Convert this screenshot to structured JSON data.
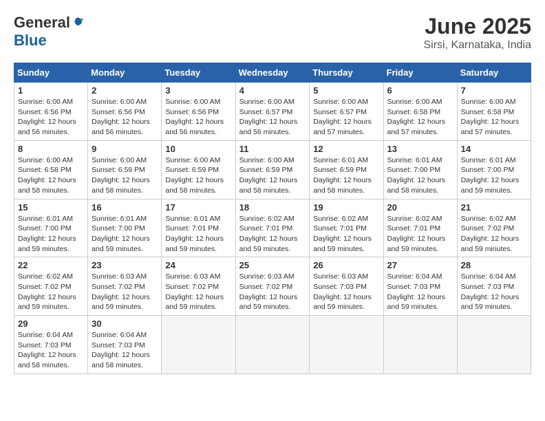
{
  "logo": {
    "general": "General",
    "blue": "Blue"
  },
  "title": "June 2025",
  "subtitle": "Sirsi, Karnataka, India",
  "days_of_week": [
    "Sunday",
    "Monday",
    "Tuesday",
    "Wednesday",
    "Thursday",
    "Friday",
    "Saturday"
  ],
  "weeks": [
    [
      {
        "num": "1",
        "info": "Sunrise: 6:00 AM\nSunset: 6:56 PM\nDaylight: 12 hours\nand 56 minutes."
      },
      {
        "num": "2",
        "info": "Sunrise: 6:00 AM\nSunset: 6:56 PM\nDaylight: 12 hours\nand 56 minutes."
      },
      {
        "num": "3",
        "info": "Sunrise: 6:00 AM\nSunset: 6:56 PM\nDaylight: 12 hours\nand 56 minutes."
      },
      {
        "num": "4",
        "info": "Sunrise: 6:00 AM\nSunset: 6:57 PM\nDaylight: 12 hours\nand 56 minutes."
      },
      {
        "num": "5",
        "info": "Sunrise: 6:00 AM\nSunset: 6:57 PM\nDaylight: 12 hours\nand 57 minutes."
      },
      {
        "num": "6",
        "info": "Sunrise: 6:00 AM\nSunset: 6:58 PM\nDaylight: 12 hours\nand 57 minutes."
      },
      {
        "num": "7",
        "info": "Sunrise: 6:00 AM\nSunset: 6:58 PM\nDaylight: 12 hours\nand 57 minutes."
      }
    ],
    [
      {
        "num": "8",
        "info": "Sunrise: 6:00 AM\nSunset: 6:58 PM\nDaylight: 12 hours\nand 58 minutes."
      },
      {
        "num": "9",
        "info": "Sunrise: 6:00 AM\nSunset: 6:59 PM\nDaylight: 12 hours\nand 58 minutes."
      },
      {
        "num": "10",
        "info": "Sunrise: 6:00 AM\nSunset: 6:59 PM\nDaylight: 12 hours\nand 58 minutes."
      },
      {
        "num": "11",
        "info": "Sunrise: 6:00 AM\nSunset: 6:59 PM\nDaylight: 12 hours\nand 58 minutes."
      },
      {
        "num": "12",
        "info": "Sunrise: 6:01 AM\nSunset: 6:59 PM\nDaylight: 12 hours\nand 58 minutes."
      },
      {
        "num": "13",
        "info": "Sunrise: 6:01 AM\nSunset: 7:00 PM\nDaylight: 12 hours\nand 58 minutes."
      },
      {
        "num": "14",
        "info": "Sunrise: 6:01 AM\nSunset: 7:00 PM\nDaylight: 12 hours\nand 59 minutes."
      }
    ],
    [
      {
        "num": "15",
        "info": "Sunrise: 6:01 AM\nSunset: 7:00 PM\nDaylight: 12 hours\nand 59 minutes."
      },
      {
        "num": "16",
        "info": "Sunrise: 6:01 AM\nSunset: 7:00 PM\nDaylight: 12 hours\nand 59 minutes."
      },
      {
        "num": "17",
        "info": "Sunrise: 6:01 AM\nSunset: 7:01 PM\nDaylight: 12 hours\nand 59 minutes."
      },
      {
        "num": "18",
        "info": "Sunrise: 6:02 AM\nSunset: 7:01 PM\nDaylight: 12 hours\nand 59 minutes."
      },
      {
        "num": "19",
        "info": "Sunrise: 6:02 AM\nSunset: 7:01 PM\nDaylight: 12 hours\nand 59 minutes."
      },
      {
        "num": "20",
        "info": "Sunrise: 6:02 AM\nSunset: 7:01 PM\nDaylight: 12 hours\nand 59 minutes."
      },
      {
        "num": "21",
        "info": "Sunrise: 6:02 AM\nSunset: 7:02 PM\nDaylight: 12 hours\nand 59 minutes."
      }
    ],
    [
      {
        "num": "22",
        "info": "Sunrise: 6:02 AM\nSunset: 7:02 PM\nDaylight: 12 hours\nand 59 minutes."
      },
      {
        "num": "23",
        "info": "Sunrise: 6:03 AM\nSunset: 7:02 PM\nDaylight: 12 hours\nand 59 minutes."
      },
      {
        "num": "24",
        "info": "Sunrise: 6:03 AM\nSunset: 7:02 PM\nDaylight: 12 hours\nand 59 minutes."
      },
      {
        "num": "25",
        "info": "Sunrise: 6:03 AM\nSunset: 7:02 PM\nDaylight: 12 hours\nand 59 minutes."
      },
      {
        "num": "26",
        "info": "Sunrise: 6:03 AM\nSunset: 7:03 PM\nDaylight: 12 hours\nand 59 minutes."
      },
      {
        "num": "27",
        "info": "Sunrise: 6:04 AM\nSunset: 7:03 PM\nDaylight: 12 hours\nand 59 minutes."
      },
      {
        "num": "28",
        "info": "Sunrise: 6:04 AM\nSunset: 7:03 PM\nDaylight: 12 hours\nand 59 minutes."
      }
    ],
    [
      {
        "num": "29",
        "info": "Sunrise: 6:04 AM\nSunset: 7:03 PM\nDaylight: 12 hours\nand 58 minutes."
      },
      {
        "num": "30",
        "info": "Sunrise: 6:04 AM\nSunset: 7:03 PM\nDaylight: 12 hours\nand 58 minutes."
      },
      null,
      null,
      null,
      null,
      null
    ]
  ]
}
